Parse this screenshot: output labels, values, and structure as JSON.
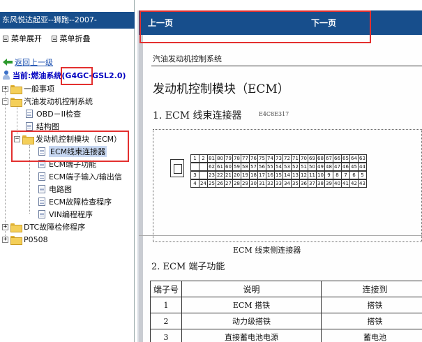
{
  "left": {
    "title": "东风悦达起亚--狮跑--2007-",
    "expand_all": "菜单展开",
    "collapse_all": "菜单折叠",
    "up_level": "返回上一级",
    "current_prefix": "当前:燃油系统",
    "current_engine": "(G4GC-GSL2.0)",
    "tree": {
      "general": "一般事项",
      "gas_engine": "汽油发动机控制系统",
      "obd": "OBD－II检查",
      "structure": "结构图",
      "ecm": "发动机控制模块（ECM）",
      "ecm_items": [
        "ECM线束连接器",
        "ECM端子功能",
        "ECM端子输入/输出信",
        "电路图",
        "ECM故障检查程序",
        "VIN编程程序"
      ],
      "dtc": "DTC故障检修程序",
      "p0508": "P0508"
    }
  },
  "right": {
    "prev": "上一页",
    "next": "下一页",
    "doc": {
      "section_header": "汽油发动机控制系统",
      "title": "发动机控制模块（ECM）",
      "sub1": "1.  ECM 线束连接器",
      "code": "E4C8E317",
      "pin_rows": [
        [
          "",
          "",
          "81",
          "80",
          "79",
          "78",
          "77",
          "76",
          "75",
          "74",
          "73",
          "72",
          "71",
          "70",
          "69",
          "68",
          "67",
          "66",
          "65",
          "64",
          "63"
        ],
        [
          "",
          "",
          "62",
          "61",
          "60",
          "59",
          "58",
          "57",
          "56",
          "55",
          "54",
          "53",
          "52",
          "51",
          "50",
          "49",
          "48",
          "47",
          "46",
          "45",
          "44"
        ],
        [
          "3",
          "",
          "23",
          "22",
          "21",
          "20",
          "19",
          "18",
          "17",
          "16",
          "15",
          "14",
          "13",
          "12",
          "11",
          "10",
          "9",
          "8",
          "7",
          "6",
          "5"
        ],
        [
          "4",
          "",
          "43",
          "42",
          "41",
          "40",
          "39",
          "38",
          "37",
          "36",
          "35",
          "34",
          "33",
          "32",
          "31",
          "30",
          "29",
          "28",
          "27",
          "26",
          "25",
          "24"
        ]
      ],
      "pin_rows_display": [
        [
          "1",
          "2",
          "81",
          "80",
          "79",
          "78",
          "77",
          "76",
          "75",
          "74",
          "73",
          "72",
          "71",
          "70",
          "69",
          "68",
          "67",
          "66",
          "65",
          "64",
          "63"
        ],
        [
          "",
          "",
          "62",
          "61",
          "60",
          "59",
          "58",
          "57",
          "56",
          "55",
          "54",
          "53",
          "52",
          "51",
          "50",
          "49",
          "48",
          "47",
          "46",
          "45",
          "44"
        ],
        [
          "3",
          "",
          "23",
          "22",
          "21",
          "20",
          "19",
          "18",
          "17",
          "16",
          "15",
          "14",
          "13",
          "12",
          "11",
          "10",
          "9",
          "8",
          "7",
          "6",
          "5"
        ],
        [
          "4",
          "24",
          "25",
          "26",
          "27",
          "28",
          "29",
          "30",
          "31",
          "32",
          "33",
          "34",
          "35",
          "36",
          "37",
          "38",
          "39",
          "40",
          "41",
          "42",
          "43"
        ]
      ],
      "connector_caption": "ECM 线束侧连接器",
      "sub2": "2.  ECM 端子功能",
      "table": {
        "headers": [
          "端子号",
          "说明",
          "连接到"
        ],
        "rows": [
          [
            "1",
            "ECM 搭铁",
            "搭铁"
          ],
          [
            "2",
            "动力级搭铁",
            "搭铁"
          ],
          [
            "3",
            "直接蓄电池电源",
            "蓄电池"
          ]
        ]
      }
    }
  },
  "colors": {
    "header_blue": "#174e8c",
    "highlight_red": "#e3302f",
    "link_blue": "#1a4fb0",
    "current_blue": "#0000c0"
  }
}
